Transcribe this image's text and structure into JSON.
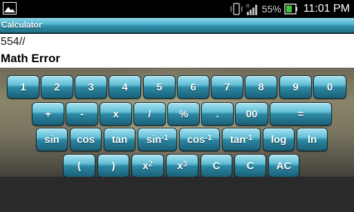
{
  "status_bar": {
    "battery_percent": "55%",
    "time": "11:01 PM",
    "icons": [
      "gallery-icon",
      "vibrate-icon",
      "signal-icon",
      "battery-icon"
    ]
  },
  "titlebar": {
    "title": "Calculator"
  },
  "display": {
    "expression": "554//",
    "result": "Math Error"
  },
  "keys": {
    "row1": [
      "1",
      "2",
      "3",
      "4",
      "5",
      "6",
      "7",
      "8",
      "9",
      "0"
    ],
    "row2": [
      "+",
      "-",
      "x",
      "/",
      "%",
      ".",
      "00",
      "="
    ],
    "row3": {
      "sin": "sin",
      "cos": "cos",
      "tan": "tan",
      "asin_base": "sin",
      "acos_base": "cos",
      "atan_base": "tan",
      "inverse_exp": "-1",
      "log": "log",
      "ln": "ln"
    },
    "row4": {
      "open_paren": "(",
      "close_paren": ")",
      "x_base": "x",
      "square_exp": "2",
      "cube_exp": "3",
      "clear1": "C",
      "clear2": "C",
      "all_clear": "AC"
    }
  },
  "colors": {
    "accent": "#2f8fa9",
    "key_top": "#a9e3f1",
    "key_bottom": "#1a6079"
  }
}
